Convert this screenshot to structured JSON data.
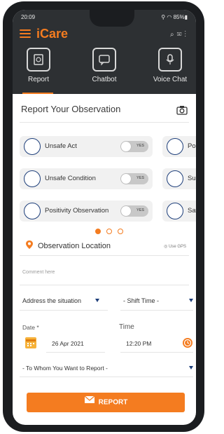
{
  "status": {
    "time": "20:09",
    "right": "⚲ ◠ 85%▮"
  },
  "app": {
    "title": "iCare"
  },
  "tabs": [
    {
      "label": "Report",
      "icon": "report-icon"
    },
    {
      "label": "Chatbot",
      "icon": "chatbot-icon"
    },
    {
      "label": "Voice Chat",
      "icon": "microphone-icon"
    }
  ],
  "section_title": "Report Your Observation",
  "cards": [
    {
      "label": "Unsafe Act",
      "toggle": "YES"
    },
    {
      "label": "Unsafe Condition",
      "toggle": "YES"
    },
    {
      "label": "Positivity Observation",
      "toggle": "YES"
    }
  ],
  "cards_partial": [
    "Pos",
    "Sus",
    "Saf"
  ],
  "location": {
    "label": "Observation Location",
    "gps": "Use GPS"
  },
  "comment_placeholder": "Comment here",
  "situation": {
    "label": "Address the situation"
  },
  "shift": {
    "label": "- Shift Time -"
  },
  "date": {
    "label": "Date *",
    "value": "26 Apr 2021"
  },
  "time": {
    "label": "Time",
    "value": "12:20 PM"
  },
  "whom": {
    "label": "- To Whom You Want to Report -"
  },
  "report_button": "REPORT",
  "colors": {
    "accent": "#f47c20",
    "dark": "#2d3033",
    "icon_blue": "#1d3e7a"
  }
}
